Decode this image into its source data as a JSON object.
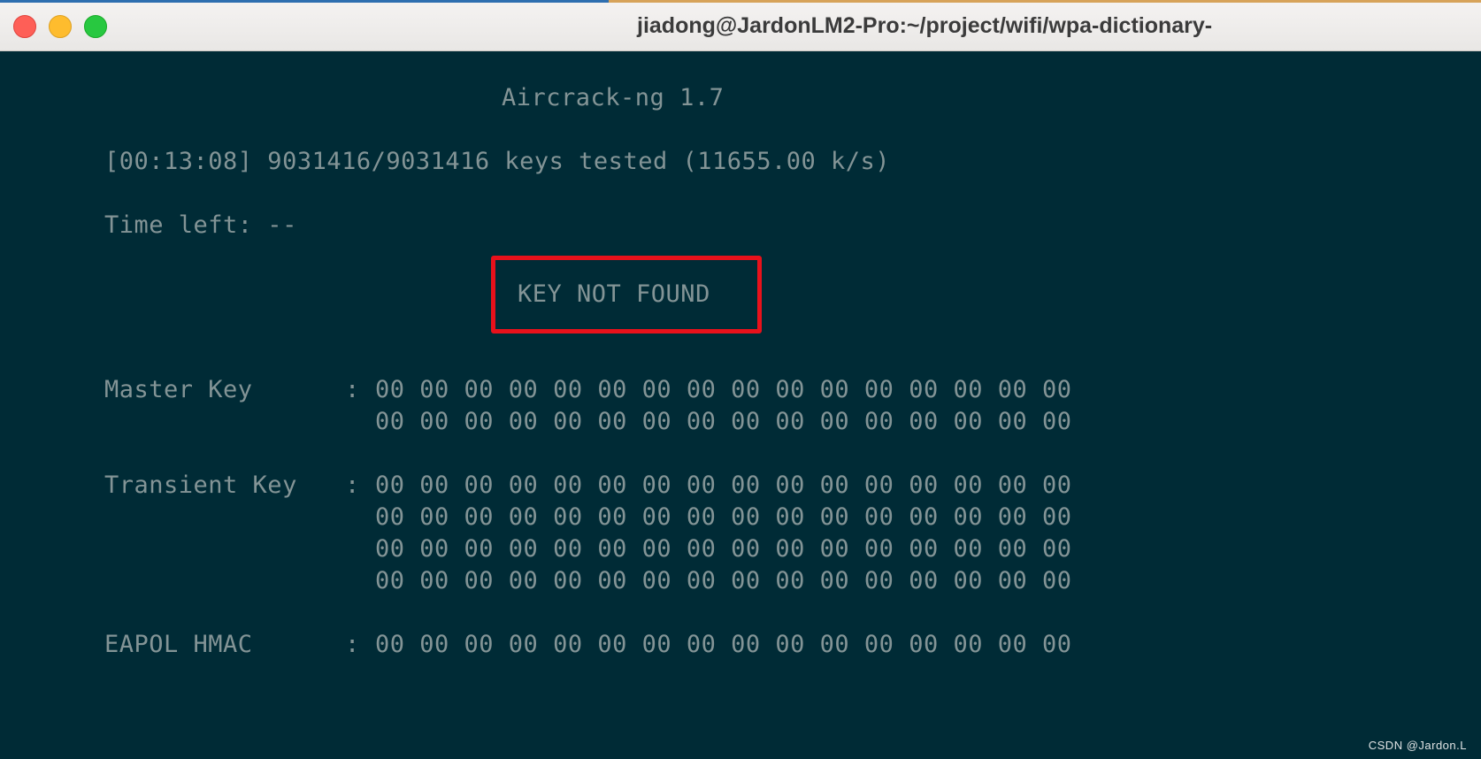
{
  "window": {
    "title": "jiadong@JardonLM2-Pro:~/project/wifi/wpa-dictionary-"
  },
  "terminal": {
    "header": "Aircrack-ng 1.7",
    "progress": "[00:13:08] 9031416/9031416 keys tested (11655.00 k/s)",
    "time_left": "Time left: --",
    "result": "KEY NOT FOUND",
    "master_key": {
      "label": "Master Key",
      "colon": ":",
      "rows": [
        "00 00 00 00 00 00 00 00 00 00 00 00 00 00 00 00",
        "00 00 00 00 00 00 00 00 00 00 00 00 00 00 00 00"
      ]
    },
    "transient_key": {
      "label": "Transient Key",
      "colon": ":",
      "rows": [
        "00 00 00 00 00 00 00 00 00 00 00 00 00 00 00 00",
        "00 00 00 00 00 00 00 00 00 00 00 00 00 00 00 00",
        "00 00 00 00 00 00 00 00 00 00 00 00 00 00 00 00",
        "00 00 00 00 00 00 00 00 00 00 00 00 00 00 00 00"
      ]
    },
    "eapol_hmac": {
      "label": "EAPOL HMAC",
      "colon": ":",
      "rows": [
        "00 00 00 00 00 00 00 00 00 00 00 00 00 00 00 00"
      ]
    }
  },
  "watermark": "CSDN @Jardon.L",
  "colors": {
    "terminal_background": "#002b36",
    "terminal_text": "#839496",
    "highlight_box": "#e8111b"
  }
}
